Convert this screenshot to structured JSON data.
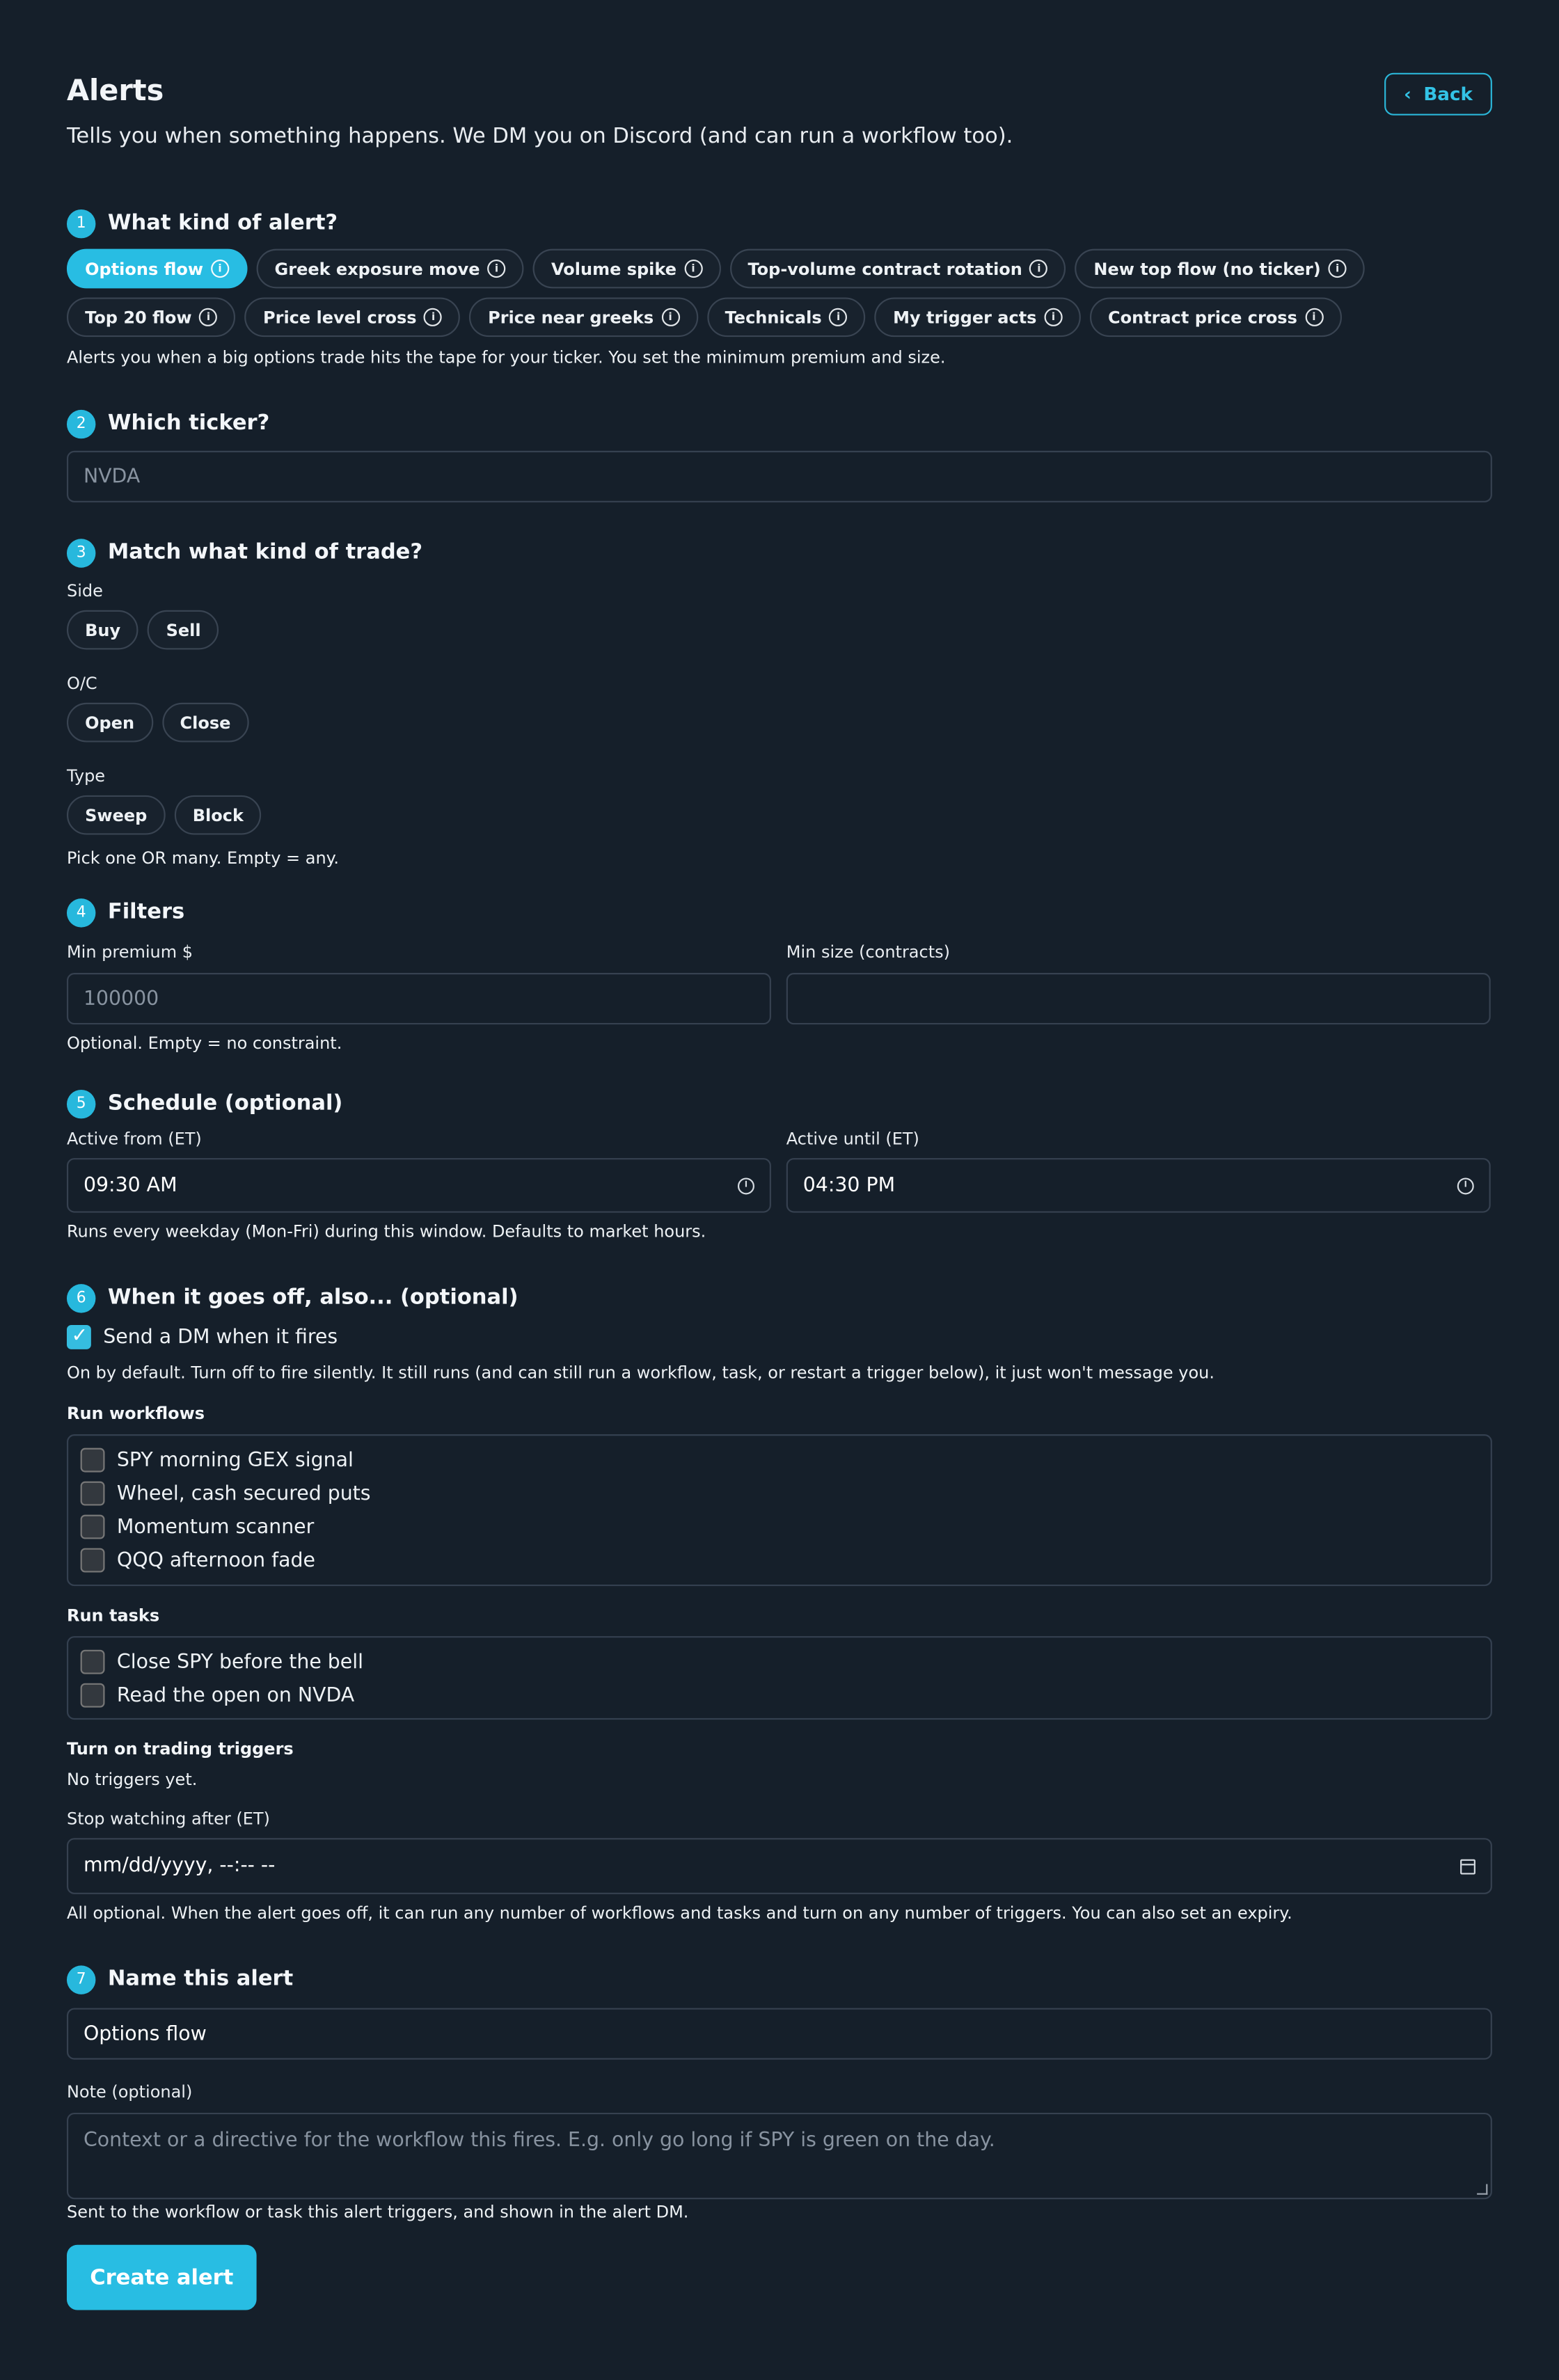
{
  "header": {
    "title": "Alerts",
    "subtitle": "Tells you when something happens. We DM you on Discord (and can run a workflow too).",
    "back_label": "Back"
  },
  "steps": {
    "one": {
      "number": "1",
      "title": "What kind of alert?",
      "help": "Alerts you when a big options trade hits the tape for your ticker. You set the minimum premium and size."
    },
    "two": {
      "number": "2",
      "title": "Which ticker?",
      "placeholder": "NVDA"
    },
    "three": {
      "number": "3",
      "title": "Match what kind of trade?",
      "help": "Pick one OR many. Empty = any."
    },
    "four": {
      "number": "4",
      "title": "Filters",
      "help": "Optional. Empty = no constraint."
    },
    "five": {
      "number": "5",
      "title": "Schedule (optional)",
      "help": "Runs every weekday (Mon-Fri) during this window. Defaults to market hours."
    },
    "six": {
      "number": "6",
      "title": "When it goes off, also... (optional)"
    },
    "seven": {
      "number": "7",
      "title": "Name this alert"
    }
  },
  "alert_types": [
    {
      "label": "Options flow",
      "active": true
    },
    {
      "label": "Greek exposure move",
      "active": false
    },
    {
      "label": "Volume spike",
      "active": false
    },
    {
      "label": "Top-volume contract rotation",
      "active": false
    },
    {
      "label": "New top flow (no ticker)",
      "active": false
    },
    {
      "label": "Top 20 flow",
      "active": false
    },
    {
      "label": "Price level cross",
      "active": false
    },
    {
      "label": "Price near greeks",
      "active": false
    },
    {
      "label": "Technicals",
      "active": false
    },
    {
      "label": "My trigger acts",
      "active": false
    },
    {
      "label": "Contract price cross",
      "active": false
    }
  ],
  "trade_match": {
    "side_label": "Side",
    "side_options": [
      "Buy",
      "Sell"
    ],
    "oc_label": "O/C",
    "oc_options": [
      "Open",
      "Close"
    ],
    "type_label": "Type",
    "type_options": [
      "Sweep",
      "Block"
    ]
  },
  "filters": {
    "min_premium_label": "Min premium $",
    "min_premium_placeholder": "100000",
    "min_size_label": "Min size (contracts)"
  },
  "schedule": {
    "from_label": "Active from (ET)",
    "from_value": "09:30 AM",
    "until_label": "Active until (ET)",
    "until_value": "04:30 PM"
  },
  "goes_off": {
    "dm_label": "Send a DM when it fires",
    "dm_checked": true,
    "dm_help": "On by default. Turn off to fire silently. It still runs (and can still run a workflow, task, or restart a trigger below), it just won't message you.",
    "workflows_title": "Run workflows",
    "workflows": [
      "SPY morning GEX signal",
      "Wheel, cash secured puts",
      "Momentum scanner",
      "QQQ afternoon fade"
    ],
    "tasks_title": "Run tasks",
    "tasks": [
      "Close SPY before the bell",
      "Read the open on NVDA"
    ],
    "triggers_title": "Turn on trading triggers",
    "triggers_empty": "No triggers yet.",
    "stop_label": "Stop watching after (ET)",
    "stop_value": "mm/dd/yyyy, --:-- --",
    "help": "All optional. When the alert goes off, it can run any number of workflows and tasks and turn on any number of triggers. You can also set an expiry."
  },
  "name_section": {
    "name_value": "Options flow",
    "note_label": "Note (optional)",
    "note_placeholder": "Context or a directive for the workflow this fires. E.g. only go long if SPY is green on the day.",
    "note_help": "Sent to the workflow or task this alert triggers, and shown in the alert DM."
  },
  "submit": {
    "label": "Create alert"
  },
  "colors": {
    "accent": "#28bde3",
    "background": "#151f2a",
    "border": "#364150"
  }
}
